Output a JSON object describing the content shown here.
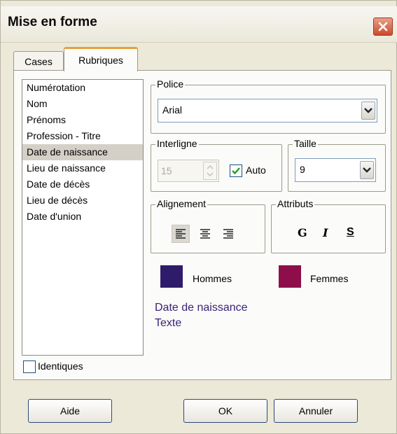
{
  "window": {
    "title": "Mise en forme",
    "close_icon": "close-icon"
  },
  "tabs": [
    {
      "label": "Cases",
      "active": false
    },
    {
      "label": "Rubriques",
      "active": true
    }
  ],
  "fields_list": {
    "items": [
      "Numérotation",
      "Nom",
      "Prénoms",
      "Profession - Titre",
      "Date de naissance",
      "Lieu de naissance",
      "Date de décès",
      "Lieu de décès",
      "Date d'union"
    ],
    "selected": "Date de naissance"
  },
  "identiques": {
    "label": "Identiques",
    "checked": false
  },
  "police": {
    "label": "Police",
    "value": "Arial"
  },
  "interligne": {
    "label": "Interligne",
    "value": "15",
    "auto_label": "Auto",
    "auto_checked": true
  },
  "taille": {
    "label": "Taille",
    "value": "9"
  },
  "alignement": {
    "label": "Alignement",
    "options": [
      "left",
      "center",
      "right"
    ],
    "selected": "left"
  },
  "attributs": {
    "label": "Attributs",
    "bold": "G",
    "italic": "I",
    "underline": "S"
  },
  "colors": {
    "hommes": {
      "label": "Hommes",
      "color": "#2e1c6b"
    },
    "femmes": {
      "label": "Femmes",
      "color": "#8e0e4a"
    }
  },
  "preview": {
    "line1": "Date de naissance",
    "line2": "Texte",
    "color": "#3a2276"
  },
  "buttons": {
    "help": "Aide",
    "ok": "OK",
    "cancel": "Annuler"
  }
}
